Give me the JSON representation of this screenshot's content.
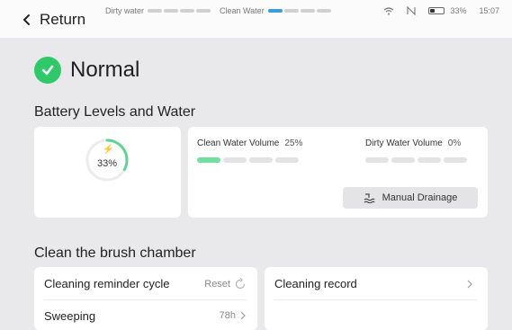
{
  "header": {
    "back_label": "Return",
    "dirty_water_label": "Dirty water",
    "clean_water_label": "Clean Water",
    "battery_percent": "33%",
    "time": "15:07"
  },
  "status": {
    "label": "Normal",
    "color": "#2fc96a"
  },
  "battery_section": {
    "title": "Battery Levels and Water",
    "battery_percent": "33%",
    "battery_level": 0.33,
    "clean_water_label": "Clean Water Volume",
    "clean_water_percent": "25%",
    "clean_water_segments_filled": 1,
    "dirty_water_label": "Dirty Water Volume",
    "dirty_water_percent": "0%",
    "dirty_water_segments_filled": 0,
    "drain_button_label": "Manual Drainage"
  },
  "brush_section": {
    "title": "Clean the brush chamber",
    "reminder_label": "Cleaning reminder cycle",
    "reset_label": "Reset",
    "sweeping_label": "Sweeping",
    "sweeping_value": "78h",
    "record_label": "Cleaning record"
  },
  "colors": {
    "accent_green": "#2fc96a",
    "clean_water_blue": "#3b9cd9",
    "bar_fill_green": "#6fe0a0"
  }
}
